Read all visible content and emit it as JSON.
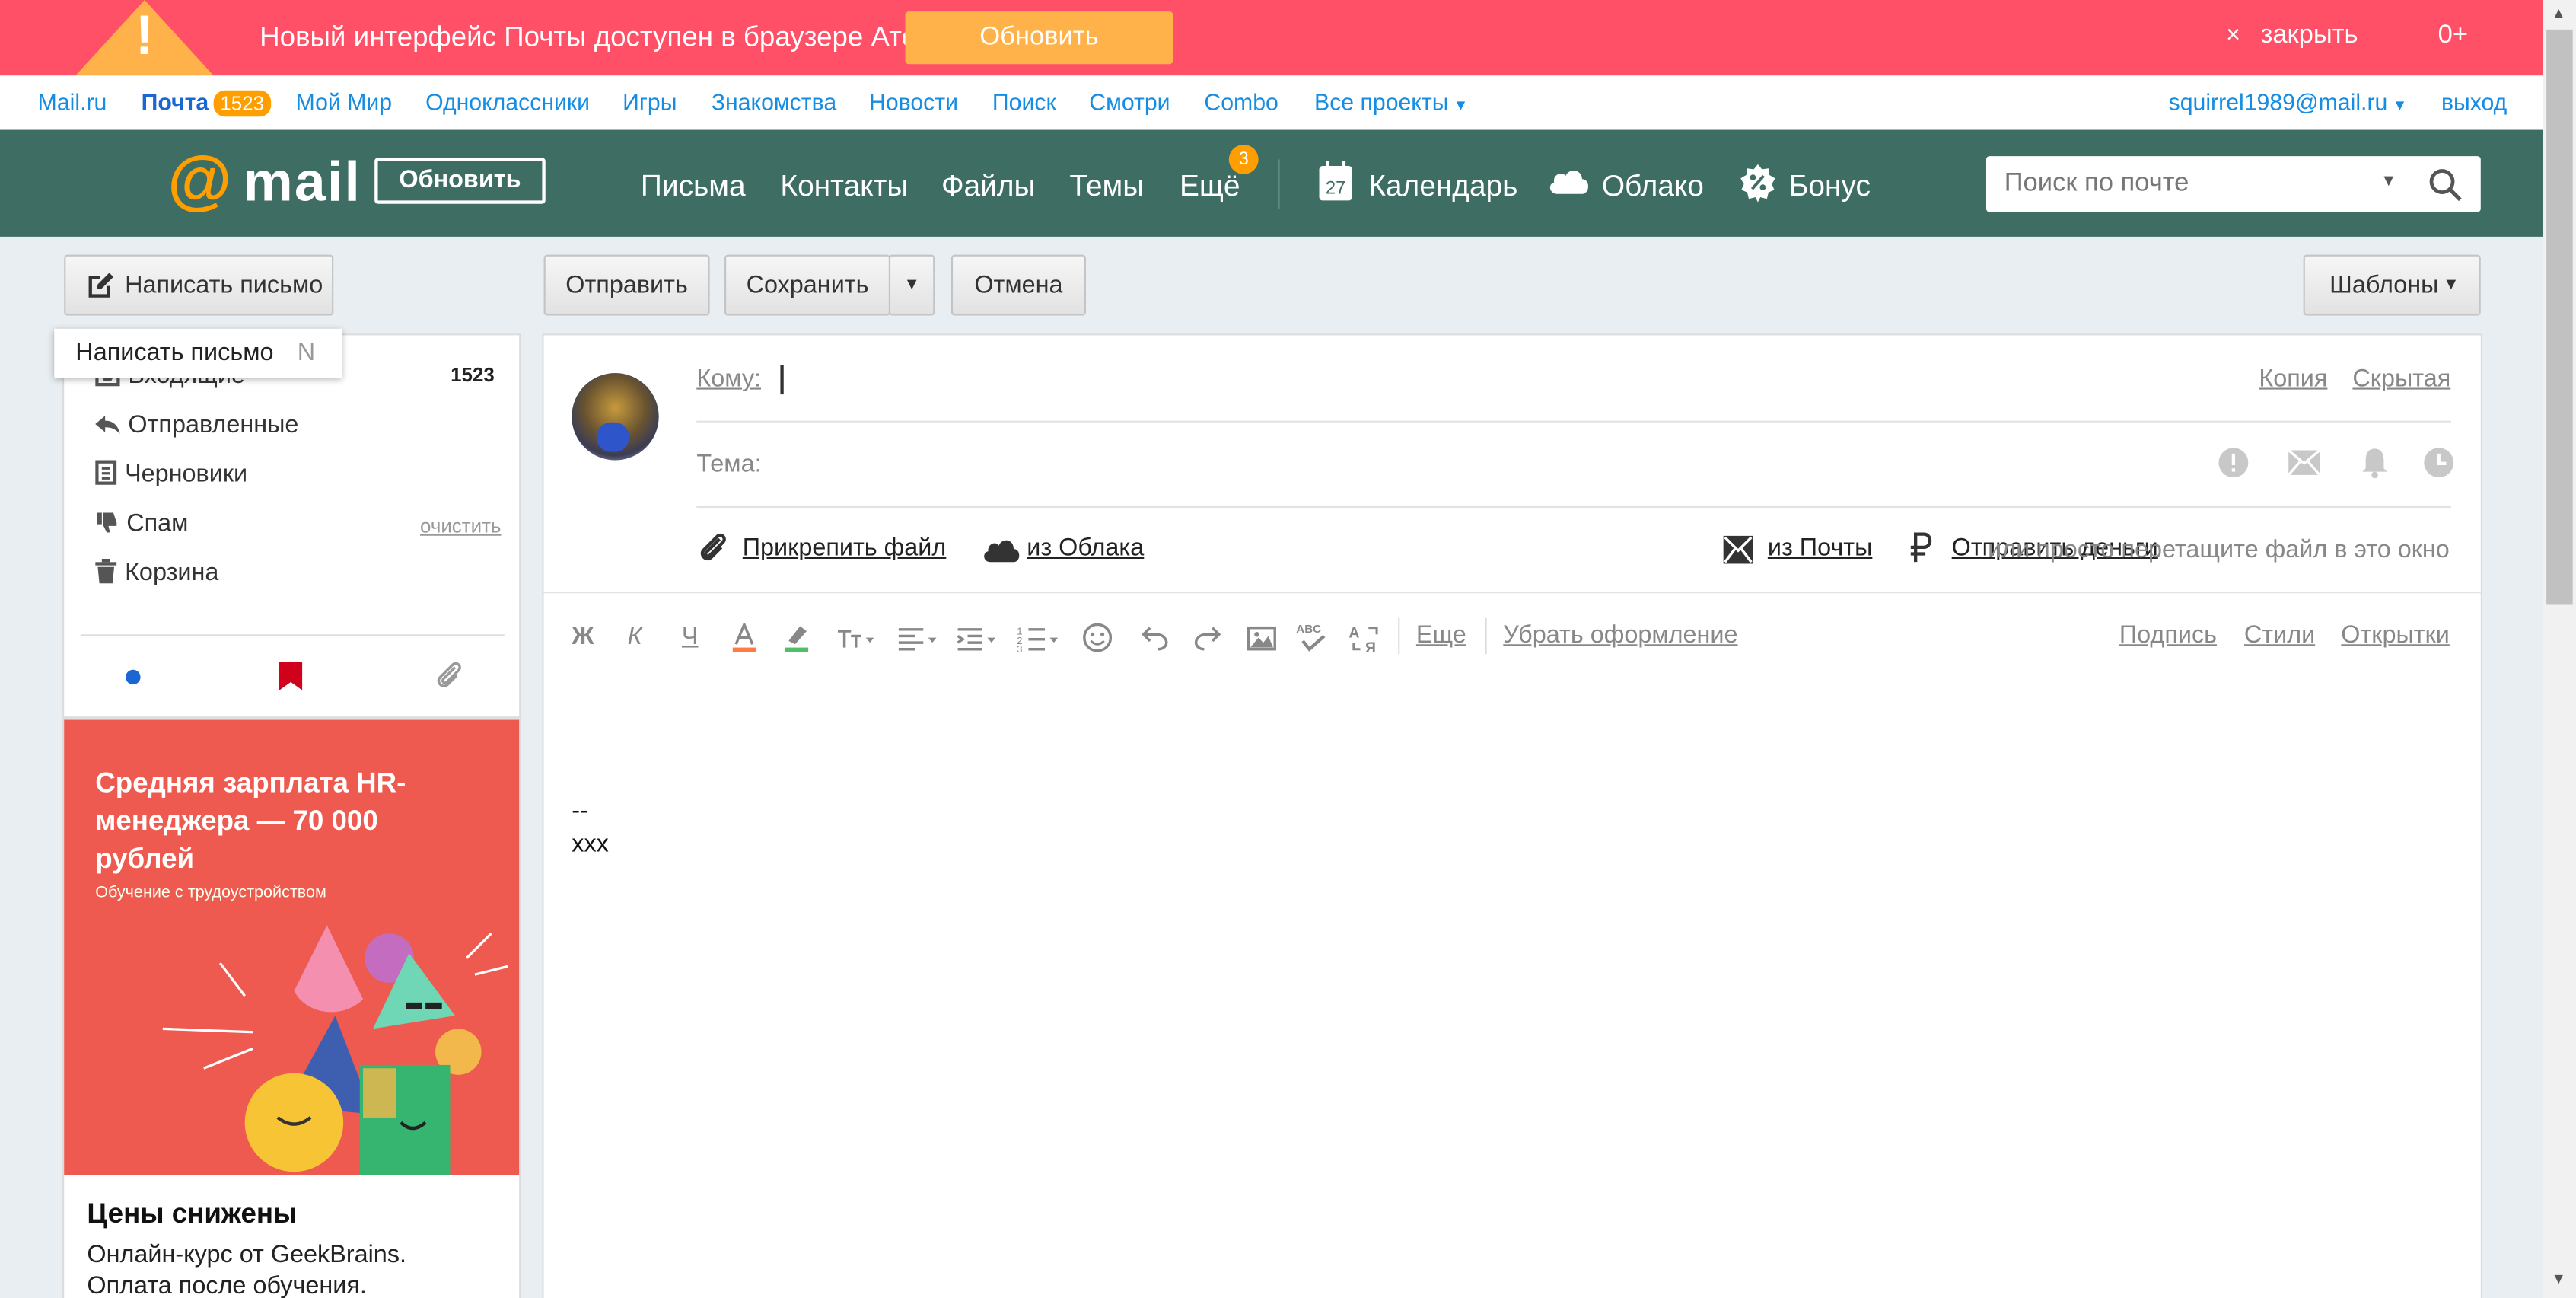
{
  "banner": {
    "message": "Новый интерфейс Почты доступен в браузере Атом",
    "update_button": "Обновить",
    "close_x": "×",
    "close_label": "закрыть",
    "age_rating": "0+"
  },
  "portal_nav": {
    "items": [
      "Mail.ru",
      "Почта",
      "Мой Мир",
      "Одноклассники",
      "Игры",
      "Знакомства",
      "Новости",
      "Поиск",
      "Смотри",
      "Combo",
      "Все проекты"
    ],
    "mail_badge": "1523",
    "user_email": "squirrel1989@mail.ru",
    "logout": "выход"
  },
  "header": {
    "logo_at": "@",
    "logo_word": "mail",
    "update_button": "Обновить",
    "nav": [
      "Письма",
      "Контакты",
      "Файлы",
      "Темы",
      "Ещё"
    ],
    "more_badge": "3",
    "calendar_day": "27",
    "calendar": "Календарь",
    "cloud": "Облако",
    "bonus": "Бонус",
    "search_placeholder": "Поиск по почте"
  },
  "toolbar": {
    "compose": "Написать письмо",
    "send": "Отправить",
    "save": "Сохранить",
    "cancel": "Отмена",
    "templates": "Шаблоны"
  },
  "tooltip": {
    "text": "Написать письмо",
    "shortcut": "N"
  },
  "folders": {
    "inbox": "Входящие",
    "inbox_count": "1523",
    "sent": "Отправленные",
    "drafts": "Черновики",
    "spam": "Спам",
    "spam_clear": "очистить",
    "trash": "Корзина"
  },
  "ad": {
    "headline": "Средняя зарплата HR-менеджера — 70 000 рублей",
    "subline": "Обучение с трудоустройством",
    "title": "Цены снижены",
    "description": "Онлайн-курс от GeekBrains. Оплата после обучения."
  },
  "compose": {
    "to_label": "Кому:",
    "cc": "Копия",
    "bcc": "Скрытая",
    "subject_label": "Тема:",
    "attach_file": "Прикрепить файл",
    "from_cloud": "из Облака",
    "from_mail": "из Почты",
    "send_money": "Отправить деньги",
    "drop_hint": "или просто перетащите файл в это окно",
    "format_bold": "Ж",
    "format_italic": "К",
    "format_underline": "Ч",
    "more": "Еще",
    "clear_format": "Убрать оформление",
    "signature_link": "Подпись",
    "styles": "Стили",
    "postcards": "Открытки",
    "signature_dash": "--",
    "signature_text": "xxx"
  },
  "colors": {
    "banner": "#ff5068",
    "accent": "#ffb24a",
    "header": "#3e6e63",
    "link": "#168de2"
  }
}
